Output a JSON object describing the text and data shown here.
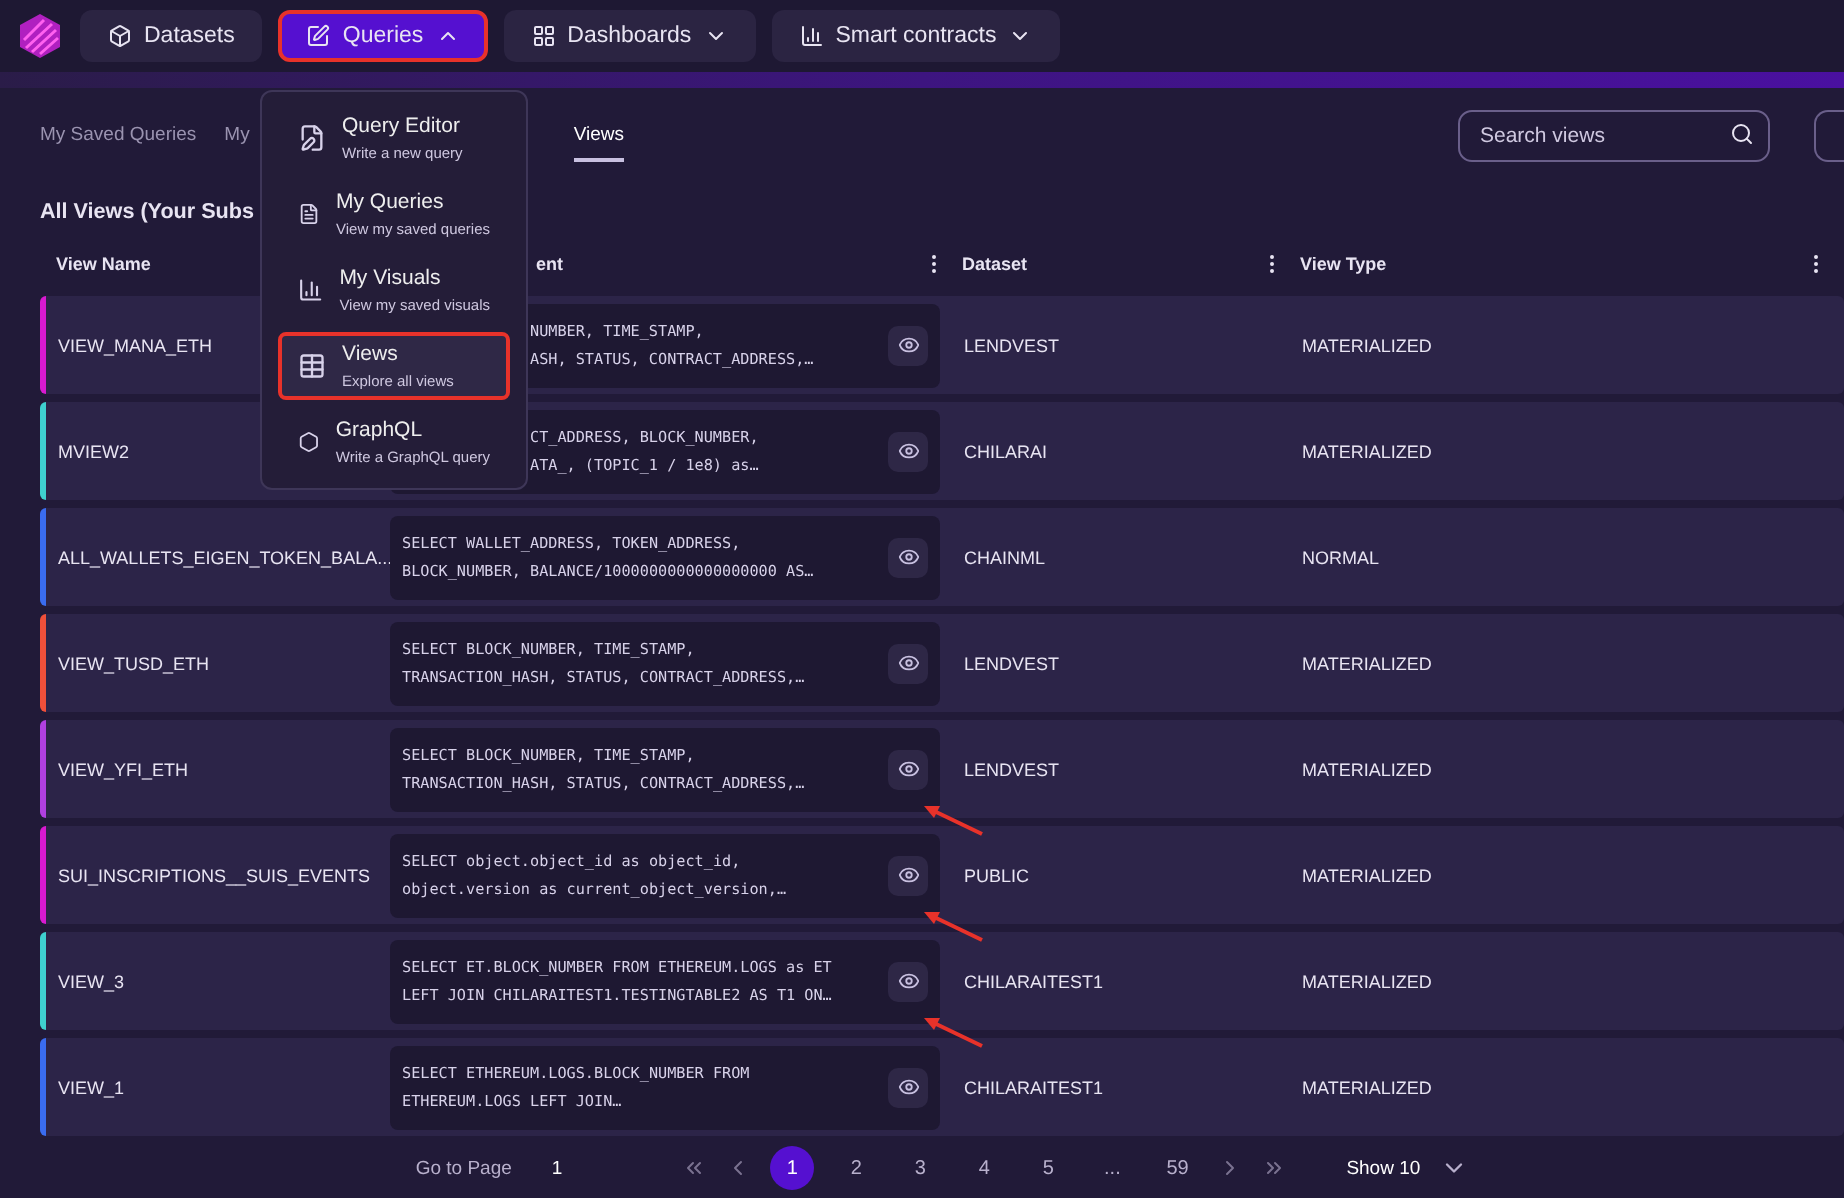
{
  "nav": [
    {
      "label": "Datasets",
      "selected": false,
      "caret": false,
      "highlighted": false
    },
    {
      "label": "Queries",
      "selected": true,
      "caret": true,
      "highlighted": true
    },
    {
      "label": "Dashboards",
      "selected": false,
      "caret": true,
      "highlighted": false
    },
    {
      "label": "Smart contracts",
      "selected": false,
      "caret": true,
      "highlighted": false
    }
  ],
  "menu": [
    {
      "title": "Query Editor",
      "subtitle": "Write a new query",
      "highlighted": false
    },
    {
      "title": "My Queries",
      "subtitle": "View my saved queries",
      "highlighted": false
    },
    {
      "title": "My Visuals",
      "subtitle": "View my saved visuals",
      "highlighted": false
    },
    {
      "title": "Views",
      "subtitle": "Explore all views",
      "highlighted": true
    },
    {
      "title": "GraphQL",
      "subtitle": "Write a GraphQL query",
      "highlighted": false
    }
  ],
  "tabs": [
    {
      "label": "My Saved Queries",
      "selected": false
    },
    {
      "label": "My",
      "selected": false
    },
    {
      "label": "Views",
      "selected": true
    }
  ],
  "search": {
    "placeholder": "Search views"
  },
  "title": "All Views (Your Subs",
  "columns": [
    "View Name",
    "ent",
    "Dataset",
    "View Type"
  ],
  "rows": [
    {
      "name": "VIEW_MANA_ETH",
      "color": "#d81ad0",
      "query": [
        "NUMBER, TIME_STAMP,",
        "ASH, STATUS, CONTRACT_ADDRESS,…"
      ],
      "covered": true,
      "dataset": "LENDVEST",
      "type": "MATERIALIZED",
      "annotated": false
    },
    {
      "name": "MVIEW2",
      "color": "#3fd0d0",
      "query": [
        "CT_ADDRESS, BLOCK_NUMBER,",
        "ATA_, (TOPIC_1 / 1e8) as…"
      ],
      "covered": true,
      "dataset": "CHILARAI",
      "type": "MATERIALIZED",
      "annotated": false
    },
    {
      "name": "ALL_WALLETS_EIGEN_TOKEN_BALA...",
      "color": "#3a6cf0",
      "query": [
        "SELECT WALLET_ADDRESS, TOKEN_ADDRESS,",
        "BLOCK_NUMBER, BALANCE/1000000000000000000 AS…"
      ],
      "covered": false,
      "dataset": "CHAINML",
      "type": "NORMAL",
      "annotated": false
    },
    {
      "name": "VIEW_TUSD_ETH",
      "color": "#f0503a",
      "query": [
        "SELECT BLOCK_NUMBER, TIME_STAMP,",
        "TRANSACTION_HASH, STATUS, CONTRACT_ADDRESS,…"
      ],
      "covered": false,
      "dataset": "LENDVEST",
      "type": "MATERIALIZED",
      "annotated": false
    },
    {
      "name": "VIEW_YFI_ETH",
      "color": "#b040e0",
      "query": [
        "SELECT BLOCK_NUMBER, TIME_STAMP,",
        "TRANSACTION_HASH, STATUS, CONTRACT_ADDRESS,…"
      ],
      "covered": false,
      "dataset": "LENDVEST",
      "type": "MATERIALIZED",
      "annotated": true
    },
    {
      "name": "SUI_INSCRIPTIONS__SUIS_EVENTS",
      "color": "#d81ad0",
      "query": [
        "SELECT object.object_id as object_id,",
        "object.version as current_object_version,…"
      ],
      "covered": false,
      "dataset": "PUBLIC",
      "type": "MATERIALIZED",
      "annotated": true
    },
    {
      "name": "VIEW_3",
      "color": "#3fd0d0",
      "query": [
        "SELECT ET.BLOCK_NUMBER FROM ETHEREUM.LOGS as ET",
        "LEFT JOIN CHILARAITEST1.TESTINGTABLE2 AS T1 ON…"
      ],
      "covered": false,
      "dataset": "CHILARAITEST1",
      "type": "MATERIALIZED",
      "annotated": true
    },
    {
      "name": "VIEW_1",
      "color": "#3a6cf0",
      "query": [
        "SELECT ETHEREUM.LOGS.BLOCK_NUMBER FROM",
        "ETHEREUM.LOGS LEFT JOIN…"
      ],
      "covered": false,
      "dataset": "CHILARAITEST1",
      "type": "MATERIALIZED",
      "annotated": false
    }
  ],
  "pagination": {
    "goto_label": "Go to Page",
    "goto_value": "1",
    "pages": [
      {
        "label": "1",
        "selected": true
      },
      {
        "label": "2",
        "selected": false
      },
      {
        "label": "3",
        "selected": false
      },
      {
        "label": "4",
        "selected": false
      },
      {
        "label": "5",
        "selected": false
      },
      {
        "label": "...",
        "selected": false
      },
      {
        "label": "59",
        "selected": false
      }
    ],
    "page_size": "Show 10"
  }
}
